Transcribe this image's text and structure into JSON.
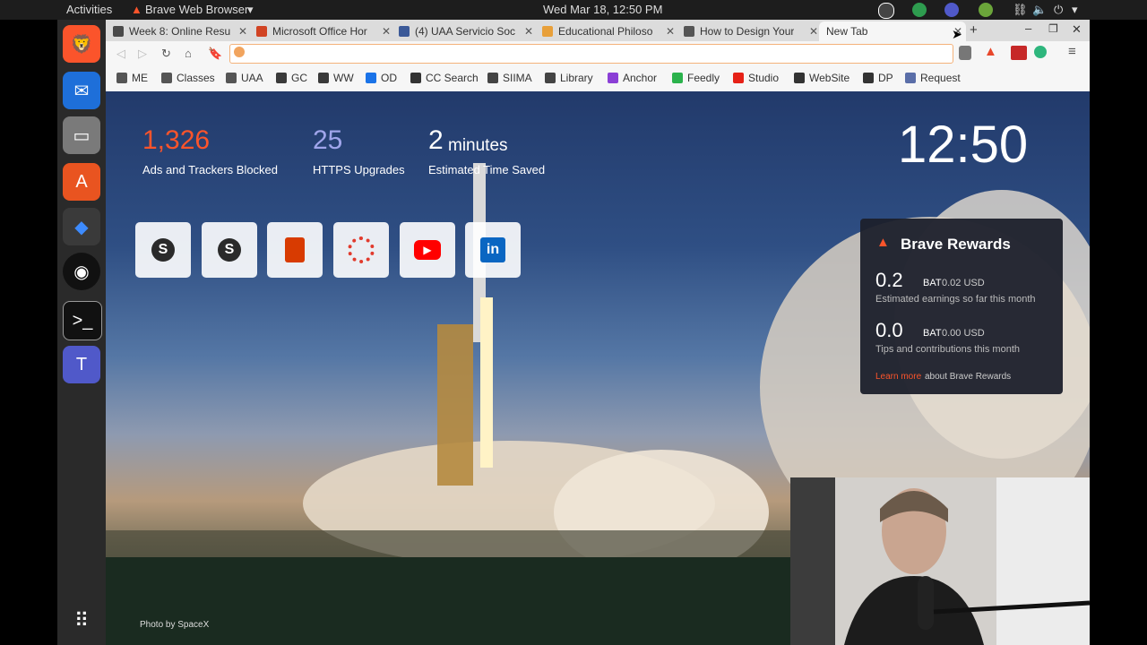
{
  "topbar": {
    "activities": "Activities",
    "app_menu": "Brave Web Browser",
    "datetime": "Wed Mar 18, 12:50 PM"
  },
  "tabs": [
    {
      "title": "Week 8: Online Resu",
      "color": "#4a4a4a"
    },
    {
      "title": "Microsoft Office Hor",
      "color": "#d14424"
    },
    {
      "title": "(4) UAA Servicio Soc",
      "color": "#3b5998"
    },
    {
      "title": "Educational Philoso",
      "color": "#e8a03a"
    },
    {
      "title": "How to Design Your",
      "color": "#555555"
    },
    {
      "title": "New Tab",
      "color": "#f6f6f6"
    }
  ],
  "bookmarks": [
    {
      "label": "ME",
      "color": "#555555"
    },
    {
      "label": "Classes",
      "color": "#555555"
    },
    {
      "label": "UAA",
      "color": "#555555"
    },
    {
      "label": "GC",
      "color": "#3a3a3a"
    },
    {
      "label": "WW",
      "color": "#3a3a3a"
    },
    {
      "label": "OD",
      "color": "#1a73e8"
    },
    {
      "label": "CC Search",
      "color": "#333333"
    },
    {
      "label": "SIIMA",
      "color": "#444444"
    },
    {
      "label": "Library",
      "color": "#444444"
    },
    {
      "label": "Anchor",
      "color": "#8b3fd6"
    },
    {
      "label": "Feedly",
      "color": "#2bb24c"
    },
    {
      "label": "Studio",
      "color": "#e62117"
    },
    {
      "label": "WebSite",
      "color": "#333333"
    },
    {
      "label": "DP",
      "color": "#333333"
    },
    {
      "label": "Request",
      "color": "#5a6ea8"
    }
  ],
  "stats": {
    "ads_count": "1,326",
    "ads_label": "Ads and Trackers Blocked",
    "https_count": "25",
    "https_label": "HTTPS Upgrades",
    "time_value": "2",
    "time_unit": "minutes",
    "time_label": "Estimated Time Saved"
  },
  "clock": "12:50",
  "rewards": {
    "title": "Brave Rewards",
    "earn_value": "0.2",
    "earn_unit": "BAT",
    "earn_usd": "0.02 USD",
    "earn_label": "Estimated earnings so far this month",
    "tips_value": "0.0",
    "tips_unit": "BAT",
    "tips_usd": "0.00 USD",
    "tips_label": "Tips and contributions this month",
    "learn_link": "Learn more",
    "learn_rest": "about Brave Rewards"
  },
  "photo_credit": "Photo by SpaceX",
  "colors": {
    "accent": "#fb542b",
    "purple": "#a0a5eb",
    "rewards_bg": "#1c202b"
  }
}
